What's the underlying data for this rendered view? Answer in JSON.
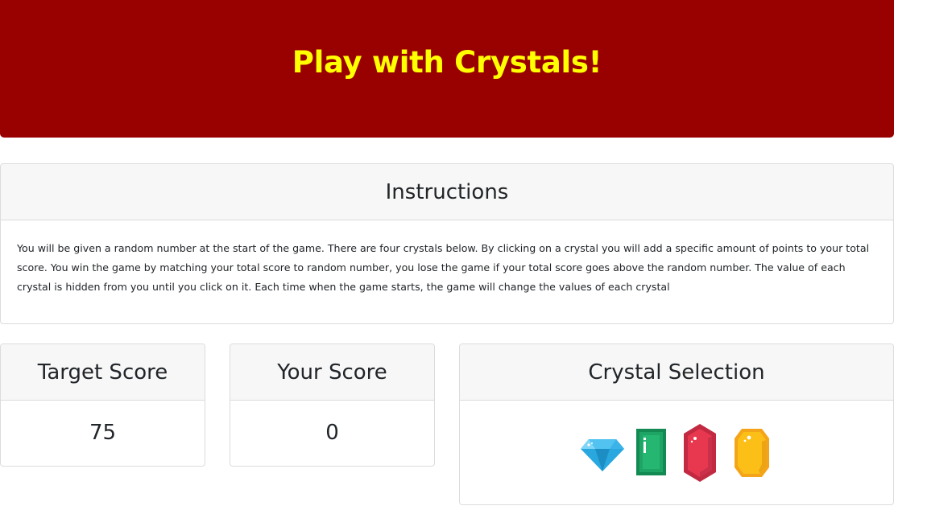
{
  "header": {
    "title": "Play with Crystals!"
  },
  "instructions": {
    "title": "Instructions",
    "text": "You will be given a random number at the start of the game. There are four crystals below. By clicking on a crystal you will add a specific amount of points to your total score. You win the game by matching your total score to random number, you lose the game if your total score goes above the random number. The value of each crystal is hidden from you until you click on it. Each time when the game starts, the game will change the values of each crystal"
  },
  "target": {
    "title": "Target Score",
    "value": "75"
  },
  "your_score": {
    "title": "Your Score",
    "value": "0"
  },
  "crystal_selection": {
    "title": "Crystal Selection",
    "crystals": [
      {
        "icon": "blue-diamond-icon",
        "color": "#29a8e0"
      },
      {
        "icon": "green-emerald-icon",
        "color": "#1ea465"
      },
      {
        "icon": "red-ruby-icon",
        "color": "#e8384f"
      },
      {
        "icon": "yellow-topaz-icon",
        "color": "#fbbf18"
      }
    ]
  },
  "colors": {
    "banner": "#990000",
    "title": "#ffff00"
  }
}
